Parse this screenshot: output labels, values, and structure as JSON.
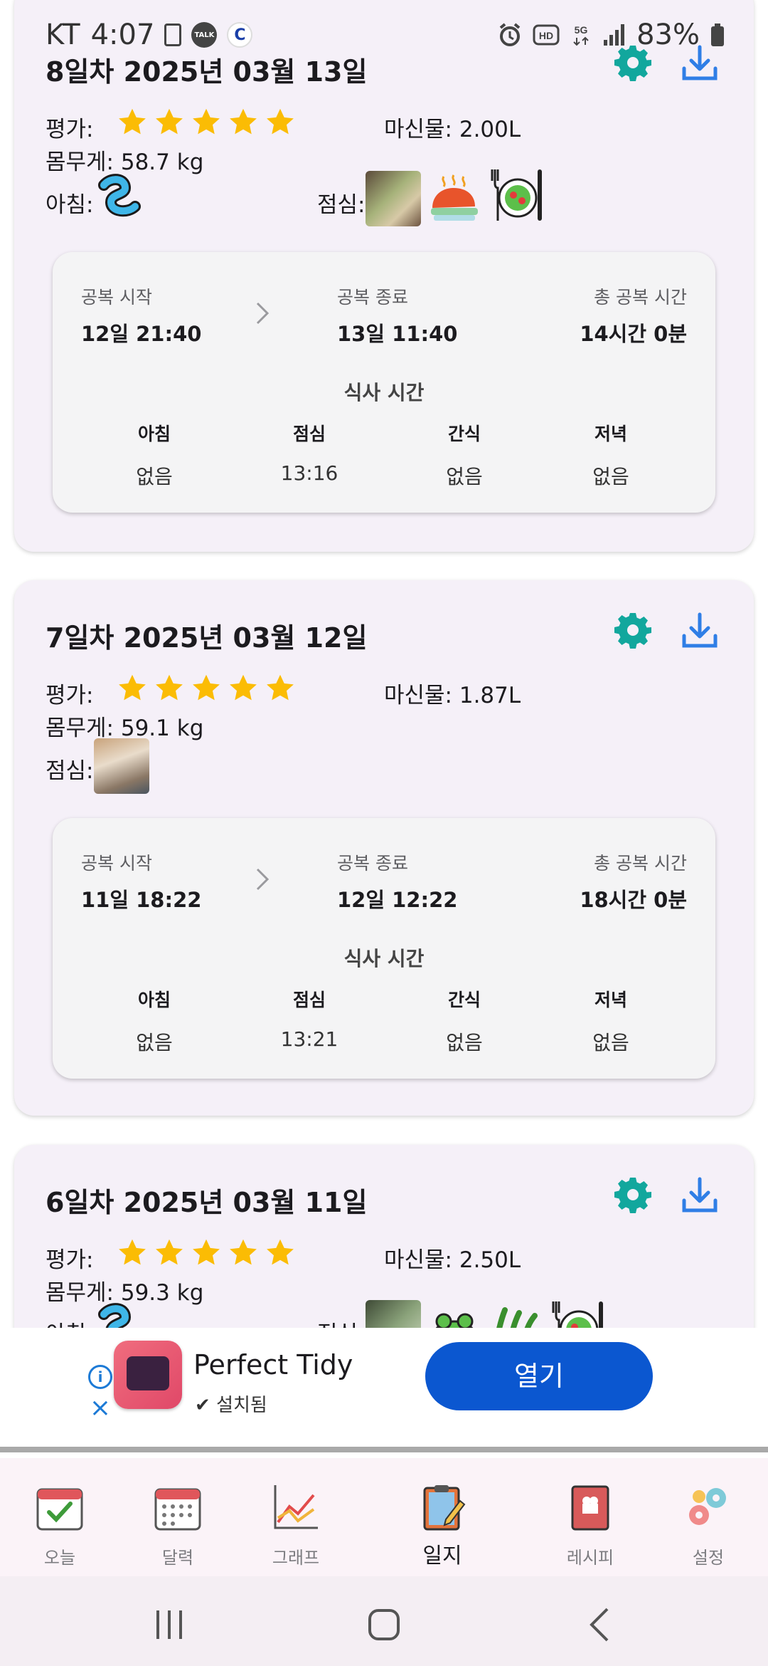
{
  "status_bar": {
    "carrier": "KT",
    "time": "4:07",
    "battery": "83%",
    "icons": [
      "sim-icon",
      "talk-icon",
      "c-icon",
      "alarm-icon",
      "hd-icon",
      "5g-icon",
      "signal-icon",
      "battery-icon"
    ]
  },
  "cards": [
    {
      "title": "8일차 2025년 03월 13일",
      "rating_label": "평가:",
      "rating": 5,
      "water": "마신물: 2.00L",
      "weight": "몸무게: 58.7 kg",
      "meals": [
        {
          "label": "아침:",
          "images": [
            "food-sausage-icon"
          ]
        },
        {
          "label": "점심:",
          "images": [
            "food-photo",
            "food-roast-icon",
            "food-salad-icon"
          ]
        }
      ],
      "fast": {
        "start_label": "공복 시작",
        "start": "12일 21:40",
        "end_label": "공복 종료",
        "end": "13일 11:40",
        "total_label": "총 공복 시간",
        "total": "14시간 0분",
        "meal_title": "식사 시간",
        "meal_times": [
          {
            "name": "아침",
            "time": "없음"
          },
          {
            "name": "점심",
            "time": "13:16"
          },
          {
            "name": "간식",
            "time": "없음"
          },
          {
            "name": "저녁",
            "time": "없음"
          }
        ]
      }
    },
    {
      "title": "7일차 2025년 03월 12일",
      "rating_label": "평가:",
      "rating": 5,
      "water": "마신물: 1.87L",
      "weight": "몸무게: 59.1 kg",
      "meals": [
        {
          "label": "점심:",
          "images": [
            "food-photo"
          ]
        }
      ],
      "fast": {
        "start_label": "공복 시작",
        "start": "11일 18:22",
        "end_label": "공복 종료",
        "end": "12일 12:22",
        "total_label": "총 공복 시간",
        "total": "18시간 0분",
        "meal_title": "식사 시간",
        "meal_times": [
          {
            "name": "아침",
            "time": "없음"
          },
          {
            "name": "점심",
            "time": "13:21"
          },
          {
            "name": "간식",
            "time": "없음"
          },
          {
            "name": "저녁",
            "time": "없음"
          }
        ]
      }
    },
    {
      "title": "6일차 2025년 03월 11일",
      "rating_label": "평가:",
      "rating": 5,
      "water": "마신물: 2.50L",
      "weight": "몸무게: 59.3 kg",
      "meals": [
        {
          "label": "아침:",
          "images": [
            "food-sausage-icon"
          ]
        },
        {
          "label": "점심:",
          "images": [
            "food-photo",
            "food-frog-icon",
            "food-leaf-icon",
            "food-salad-icon"
          ]
        }
      ]
    }
  ],
  "ad": {
    "app_name": "Perfect Tidy",
    "status": "설치됨",
    "open_label": "열기"
  },
  "bottom_nav": [
    {
      "label": "오늘",
      "icon": "calendar-check-icon"
    },
    {
      "label": "달력",
      "icon": "calendar-icon"
    },
    {
      "label": "그래프",
      "icon": "graph-icon"
    },
    {
      "label": "일지",
      "icon": "journal-icon",
      "active": true
    },
    {
      "label": "레시피",
      "icon": "recipe-book-icon"
    },
    {
      "label": "설정",
      "icon": "settings-gears-icon"
    }
  ],
  "colors": {
    "card_bg": "#f5f0f8",
    "star": "#fbbc04",
    "gear": "#12a79d",
    "download": "#2f7ee6",
    "ad_button": "#0b57d0"
  }
}
